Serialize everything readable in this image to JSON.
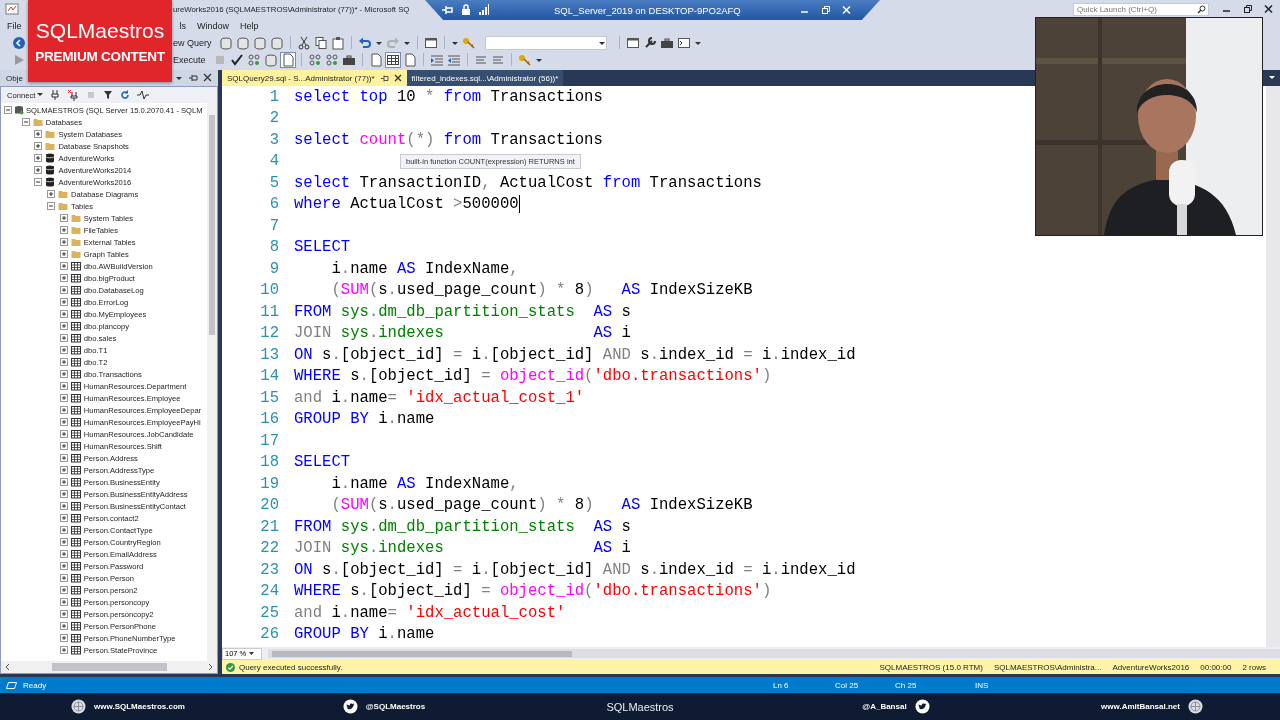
{
  "title_bar": {
    "title": "ureWorks2016 (SQLMAESTROS\\Administrator (77))* - Microsoft SQ",
    "remote_session": "SQL_Server_2019 on DESKTOP-9PO2AFQ",
    "quick_launch": {
      "placeholder": "Quick Launch (Ctrl+Q)"
    }
  },
  "badge": {
    "brand": "SQLMaestros",
    "tagline": "PREMIUM CONTENT"
  },
  "menu": [
    "File",
    "ls",
    "Window",
    "Help"
  ],
  "toolbar": {
    "new_query": "ew Query",
    "execute": "Execute"
  },
  "object_explorer": {
    "title": "Obje",
    "connect": "Connect",
    "tree": [
      {
        "label": "SQLMAESTROS (SQL Server 15.0.2070.41 - SQLM",
        "kind": "server",
        "expanded": true,
        "children": [
          {
            "label": "Databases",
            "kind": "folder",
            "expanded": true,
            "children": [
              {
                "label": "System Databases",
                "kind": "folder",
                "expanded": false
              },
              {
                "label": "Database Snapshots",
                "kind": "folder",
                "expanded": false
              },
              {
                "label": "AdventureWorks",
                "kind": "database",
                "expanded": false
              },
              {
                "label": "AdventureWorks2014",
                "kind": "database",
                "expanded": false
              },
              {
                "label": "AdventureWorks2016",
                "kind": "database",
                "expanded": true,
                "children": [
                  {
                    "label": "Database Diagrams",
                    "kind": "folder",
                    "expanded": false
                  },
                  {
                    "label": "Tables",
                    "kind": "folder",
                    "expanded": true,
                    "children": [
                      {
                        "label": "System Tables",
                        "kind": "folder",
                        "expanded": false
                      },
                      {
                        "label": "FileTables",
                        "kind": "folder",
                        "expanded": false
                      },
                      {
                        "label": "External Tables",
                        "kind": "folder",
                        "expanded": false
                      },
                      {
                        "label": "Graph Tables",
                        "kind": "folder",
                        "expanded": false
                      },
                      {
                        "label": "dbo.AWBuildVersion",
                        "kind": "table",
                        "expanded": false
                      },
                      {
                        "label": "dbo.bigProduct",
                        "kind": "table",
                        "expanded": false
                      },
                      {
                        "label": "dbo.DatabaseLog",
                        "kind": "table",
                        "expanded": false
                      },
                      {
                        "label": "dbo.ErrorLog",
                        "kind": "table",
                        "expanded": false
                      },
                      {
                        "label": "dbo.MyEmployees",
                        "kind": "table",
                        "expanded": false
                      },
                      {
                        "label": "dbo.plancopy",
                        "kind": "table",
                        "expanded": false
                      },
                      {
                        "label": "dbo.sales",
                        "kind": "table",
                        "expanded": false
                      },
                      {
                        "label": "dbo.T1",
                        "kind": "table",
                        "expanded": false
                      },
                      {
                        "label": "dbo.T2",
                        "kind": "table",
                        "expanded": false
                      },
                      {
                        "label": "dbo.Transactions",
                        "kind": "table",
                        "expanded": false
                      },
                      {
                        "label": "HumanResources.Department",
                        "kind": "table",
                        "expanded": false
                      },
                      {
                        "label": "HumanResources.Employee",
                        "kind": "table",
                        "expanded": false
                      },
                      {
                        "label": "HumanResources.EmployeeDepar",
                        "kind": "table",
                        "expanded": false
                      },
                      {
                        "label": "HumanResources.EmployeePayHi",
                        "kind": "table",
                        "expanded": false
                      },
                      {
                        "label": "HumanResources.JobCandidate",
                        "kind": "table",
                        "expanded": false
                      },
                      {
                        "label": "HumanResources.Shift",
                        "kind": "table",
                        "expanded": false
                      },
                      {
                        "label": "Person.Address",
                        "kind": "table",
                        "expanded": false
                      },
                      {
                        "label": "Person.AddressType",
                        "kind": "table",
                        "expanded": false
                      },
                      {
                        "label": "Person.BusinessEntity",
                        "kind": "table",
                        "expanded": false
                      },
                      {
                        "label": "Person.BusinessEntityAddress",
                        "kind": "table",
                        "expanded": false
                      },
                      {
                        "label": "Person.BusinessEntityContact",
                        "kind": "table",
                        "expanded": false
                      },
                      {
                        "label": "Person.contact2",
                        "kind": "table",
                        "expanded": false
                      },
                      {
                        "label": "Person.ContactType",
                        "kind": "table",
                        "expanded": false
                      },
                      {
                        "label": "Person.CountryRegion",
                        "kind": "table",
                        "expanded": false
                      },
                      {
                        "label": "Person.EmailAddress",
                        "kind": "table",
                        "expanded": false
                      },
                      {
                        "label": "Person.Password",
                        "kind": "table",
                        "expanded": false
                      },
                      {
                        "label": "Person.Person",
                        "kind": "table",
                        "expanded": false
                      },
                      {
                        "label": "Person.person2",
                        "kind": "table",
                        "expanded": false
                      },
                      {
                        "label": "Person.personcopy",
                        "kind": "table",
                        "expanded": false
                      },
                      {
                        "label": "Person.personcopy2",
                        "kind": "table",
                        "expanded": false
                      },
                      {
                        "label": "Person.PersonPhone",
                        "kind": "table",
                        "expanded": false
                      },
                      {
                        "label": "Person.PhoneNumberType",
                        "kind": "table",
                        "expanded": false
                      },
                      {
                        "label": "Person.StateProvince",
                        "kind": "table",
                        "expanded": false
                      }
                    ]
                  }
                ]
              }
            ]
          }
        ]
      }
    ]
  },
  "tabs": [
    {
      "label": "SQLQuery29.sql - S...Administrator (77))*",
      "selected": true
    },
    {
      "label": "filtered_indexes.sql...\\Administrator (56))*",
      "selected": false
    }
  ],
  "editor": {
    "tooltip": "built-in function COUNT(expression) RETURNS int",
    "zoom": "107 %",
    "lines": [
      {
        "number": "1",
        "caret": false,
        "segments": [
          {
            "text": "select top ",
            "kind": "keyword"
          },
          {
            "text": "10 ",
            "kind": "plain"
          },
          {
            "text": "* ",
            "kind": "operator"
          },
          {
            "text": "from",
            "kind": "keyword"
          },
          {
            "text": " Transactions",
            "kind": "plain"
          }
        ]
      },
      {
        "number": "2",
        "caret": false
      },
      {
        "number": "3",
        "caret": false,
        "segments": [
          {
            "text": "select ",
            "kind": "keyword"
          },
          {
            "text": "count",
            "kind": "function"
          },
          {
            "text": "(*) ",
            "kind": "operator"
          },
          {
            "text": "from",
            "kind": "keyword"
          },
          {
            "text": " Transactions",
            "kind": "plain"
          }
        ]
      },
      {
        "number": "4",
        "caret": false
      },
      {
        "number": "5",
        "caret": false,
        "segments": [
          {
            "text": "select ",
            "kind": "keyword"
          },
          {
            "text": "TransactionID",
            "kind": "plain"
          },
          {
            "text": ",",
            "kind": "operator"
          },
          {
            "text": " ActualCost ",
            "kind": "plain"
          },
          {
            "text": "from",
            "kind": "keyword"
          },
          {
            "text": " Transactions",
            "kind": "plain"
          }
        ]
      },
      {
        "number": "6",
        "caret": true,
        "segments": [
          {
            "text": "where ",
            "kind": "keyword"
          },
          {
            "text": "ActualCost ",
            "kind": "plain"
          },
          {
            "text": ">",
            "kind": "operator"
          },
          {
            "text": "500000",
            "kind": "plain"
          }
        ]
      },
      {
        "number": "7",
        "caret": false
      },
      {
        "number": "8",
        "caret": false,
        "segments": [
          {
            "text": "SELECT",
            "kind": "keyword"
          }
        ]
      },
      {
        "number": "9",
        "caret": false,
        "segments": [
          {
            "text": "    i",
            "kind": "plain"
          },
          {
            "text": ".",
            "kind": "operator"
          },
          {
            "text": "name ",
            "kind": "plain"
          },
          {
            "text": "AS ",
            "kind": "keyword"
          },
          {
            "text": "IndexName",
            "kind": "plain"
          },
          {
            "text": ",",
            "kind": "operator"
          }
        ]
      },
      {
        "number": "10",
        "caret": false,
        "segments": [
          {
            "text": "    (",
            "kind": "operator"
          },
          {
            "text": "SUM",
            "kind": "function"
          },
          {
            "text": "(",
            "kind": "operator"
          },
          {
            "text": "s",
            "kind": "plain"
          },
          {
            "text": ".",
            "kind": "operator"
          },
          {
            "text": "used_page_count",
            "kind": "plain"
          },
          {
            "text": ") * ",
            "kind": "operator"
          },
          {
            "text": "8",
            "kind": "plain"
          },
          {
            "text": ")",
            "kind": "operator"
          },
          {
            "text": "   AS ",
            "kind": "keyword"
          },
          {
            "text": "IndexSizeKB",
            "kind": "plain"
          }
        ]
      },
      {
        "number": "11",
        "caret": false,
        "segments": [
          {
            "text": "FROM ",
            "kind": "keyword"
          },
          {
            "text": "sys",
            "kind": "system"
          },
          {
            "text": ".",
            "kind": "operator"
          },
          {
            "text": "dm_db_partition_stats",
            "kind": "system"
          },
          {
            "text": "  AS ",
            "kind": "keyword"
          },
          {
            "text": "s",
            "kind": "plain"
          }
        ]
      },
      {
        "number": "12",
        "caret": false,
        "segments": [
          {
            "text": "JOIN ",
            "kind": "operator"
          },
          {
            "text": "sys",
            "kind": "system"
          },
          {
            "text": ".",
            "kind": "operator"
          },
          {
            "text": "indexes",
            "kind": "system"
          },
          {
            "text": "                AS ",
            "kind": "keyword"
          },
          {
            "text": "i",
            "kind": "plain"
          }
        ]
      },
      {
        "number": "13",
        "caret": false,
        "segments": [
          {
            "text": "ON ",
            "kind": "keyword"
          },
          {
            "text": "s",
            "kind": "plain"
          },
          {
            "text": ".",
            "kind": "operator"
          },
          {
            "text": "[object_id] ",
            "kind": "plain"
          },
          {
            "text": "=",
            "kind": "operator"
          },
          {
            "text": " i",
            "kind": "plain"
          },
          {
            "text": ".",
            "kind": "operator"
          },
          {
            "text": "[object_id] ",
            "kind": "plain"
          },
          {
            "text": "AND ",
            "kind": "operator"
          },
          {
            "text": "s",
            "kind": "plain"
          },
          {
            "text": ".",
            "kind": "operator"
          },
          {
            "text": "index_id ",
            "kind": "plain"
          },
          {
            "text": "=",
            "kind": "operator"
          },
          {
            "text": " i",
            "kind": "plain"
          },
          {
            "text": ".",
            "kind": "operator"
          },
          {
            "text": "index_id",
            "kind": "plain"
          }
        ]
      },
      {
        "number": "14",
        "caret": false,
        "segments": [
          {
            "text": "WHERE ",
            "kind": "keyword"
          },
          {
            "text": "s",
            "kind": "plain"
          },
          {
            "text": ".",
            "kind": "operator"
          },
          {
            "text": "[object_id] ",
            "kind": "plain"
          },
          {
            "text": "=",
            "kind": "operator"
          },
          {
            "text": " object_id",
            "kind": "function"
          },
          {
            "text": "(",
            "kind": "operator"
          },
          {
            "text": "'dbo.transactions'",
            "kind": "string"
          },
          {
            "text": ")",
            "kind": "operator"
          }
        ]
      },
      {
        "number": "15",
        "caret": false,
        "segments": [
          {
            "text": "and ",
            "kind": "operator"
          },
          {
            "text": "i",
            "kind": "plain"
          },
          {
            "text": ".",
            "kind": "operator"
          },
          {
            "text": "name",
            "kind": "plain"
          },
          {
            "text": "=",
            "kind": "operator"
          },
          {
            "text": " 'idx_actual_cost_1'",
            "kind": "string"
          }
        ]
      },
      {
        "number": "16",
        "caret": false,
        "segments": [
          {
            "text": "GROUP BY ",
            "kind": "keyword"
          },
          {
            "text": "i",
            "kind": "plain"
          },
          {
            "text": ".",
            "kind": "operator"
          },
          {
            "text": "name",
            "kind": "plain"
          }
        ]
      },
      {
        "number": "17",
        "caret": false
      },
      {
        "number": "18",
        "caret": false,
        "segments": [
          {
            "text": "SELECT",
            "kind": "keyword"
          }
        ]
      },
      {
        "number": "19",
        "caret": false,
        "segments": [
          {
            "text": "    i",
            "kind": "plain"
          },
          {
            "text": ".",
            "kind": "operator"
          },
          {
            "text": "name ",
            "kind": "plain"
          },
          {
            "text": "AS ",
            "kind": "keyword"
          },
          {
            "text": "IndexName",
            "kind": "plain"
          },
          {
            "text": ",",
            "kind": "operator"
          }
        ]
      },
      {
        "number": "20",
        "caret": false,
        "segments": [
          {
            "text": "    (",
            "kind": "operator"
          },
          {
            "text": "SUM",
            "kind": "function"
          },
          {
            "text": "(",
            "kind": "operator"
          },
          {
            "text": "s",
            "kind": "plain"
          },
          {
            "text": ".",
            "kind": "operator"
          },
          {
            "text": "used_page_count",
            "kind": "plain"
          },
          {
            "text": ") * ",
            "kind": "operator"
          },
          {
            "text": "8",
            "kind": "plain"
          },
          {
            "text": ")",
            "kind": "operator"
          },
          {
            "text": "   AS ",
            "kind": "keyword"
          },
          {
            "text": "IndexSizeKB",
            "kind": "plain"
          }
        ]
      },
      {
        "number": "21",
        "caret": false,
        "segments": [
          {
            "text": "FROM ",
            "kind": "keyword"
          },
          {
            "text": "sys",
            "kind": "system"
          },
          {
            "text": ".",
            "kind": "operator"
          },
          {
            "text": "dm_db_partition_stats",
            "kind": "system"
          },
          {
            "text": "  AS ",
            "kind": "keyword"
          },
          {
            "text": "s",
            "kind": "plain"
          }
        ]
      },
      {
        "number": "22",
        "caret": false,
        "segments": [
          {
            "text": "JOIN ",
            "kind": "operator"
          },
          {
            "text": "sys",
            "kind": "system"
          },
          {
            "text": ".",
            "kind": "operator"
          },
          {
            "text": "indexes",
            "kind": "system"
          },
          {
            "text": "                AS ",
            "kind": "keyword"
          },
          {
            "text": "i",
            "kind": "plain"
          }
        ]
      },
      {
        "number": "23",
        "caret": false,
        "segments": [
          {
            "text": "ON ",
            "kind": "keyword"
          },
          {
            "text": "s",
            "kind": "plain"
          },
          {
            "text": ".",
            "kind": "operator"
          },
          {
            "text": "[object_id] ",
            "kind": "plain"
          },
          {
            "text": "=",
            "kind": "operator"
          },
          {
            "text": " i",
            "kind": "plain"
          },
          {
            "text": ".",
            "kind": "operator"
          },
          {
            "text": "[object_id] ",
            "kind": "plain"
          },
          {
            "text": "AND ",
            "kind": "operator"
          },
          {
            "text": "s",
            "kind": "plain"
          },
          {
            "text": ".",
            "kind": "operator"
          },
          {
            "text": "index_id ",
            "kind": "plain"
          },
          {
            "text": "=",
            "kind": "operator"
          },
          {
            "text": " i",
            "kind": "plain"
          },
          {
            "text": ".",
            "kind": "operator"
          },
          {
            "text": "index_id",
            "kind": "plain"
          }
        ]
      },
      {
        "number": "24",
        "caret": false,
        "segments": [
          {
            "text": "WHERE ",
            "kind": "keyword"
          },
          {
            "text": "s",
            "kind": "plain"
          },
          {
            "text": ".",
            "kind": "operator"
          },
          {
            "text": "[object_id] ",
            "kind": "plain"
          },
          {
            "text": "=",
            "kind": "operator"
          },
          {
            "text": " object_id",
            "kind": "function"
          },
          {
            "text": "(",
            "kind": "operator"
          },
          {
            "text": "'dbo.transactions'",
            "kind": "string"
          },
          {
            "text": ")",
            "kind": "operator"
          }
        ]
      },
      {
        "number": "25",
        "caret": false,
        "segments": [
          {
            "text": "and ",
            "kind": "operator"
          },
          {
            "text": "i",
            "kind": "plain"
          },
          {
            "text": ".",
            "kind": "operator"
          },
          {
            "text": "name",
            "kind": "plain"
          },
          {
            "text": "=",
            "kind": "operator"
          },
          {
            "text": " 'idx_actual_cost'",
            "kind": "string"
          }
        ]
      },
      {
        "number": "26",
        "caret": false,
        "segments": [
          {
            "text": "GROUP BY ",
            "kind": "keyword"
          },
          {
            "text": "i",
            "kind": "plain"
          },
          {
            "text": ".",
            "kind": "operator"
          },
          {
            "text": "name",
            "kind": "plain"
          }
        ]
      }
    ]
  },
  "query_status": {
    "message": "Query executed successfully.",
    "items": [
      "SQLMAESTROS (15.0 RTM)",
      "SQLMAESTROS\\Administra...",
      "AdventureWorks2016",
      "00:00:00",
      "2 rows"
    ]
  },
  "status_bar": {
    "state": "Ready",
    "items": [
      "Ln 6",
      "Col 25",
      "Ch 25",
      "INS"
    ]
  },
  "webcam": {
    "kind": "picture"
  },
  "footer": {
    "groups": [
      [
        {
          "kind": "globe"
        },
        {
          "kind": "link",
          "text": "www.SQLMaestros.com"
        }
      ],
      [
        {
          "kind": "bird"
        },
        {
          "kind": "link",
          "text": "@SQLMaestros"
        }
      ],
      [
        {
          "kind": "logo",
          "text": "SQLMaestros"
        }
      ],
      [
        {
          "kind": "link",
          "text": "@A_Bansal"
        },
        {
          "kind": "bird"
        }
      ],
      [
        {
          "kind": "link",
          "text": "www.AmitBansal.net"
        },
        {
          "kind": "globe"
        }
      ]
    ]
  }
}
